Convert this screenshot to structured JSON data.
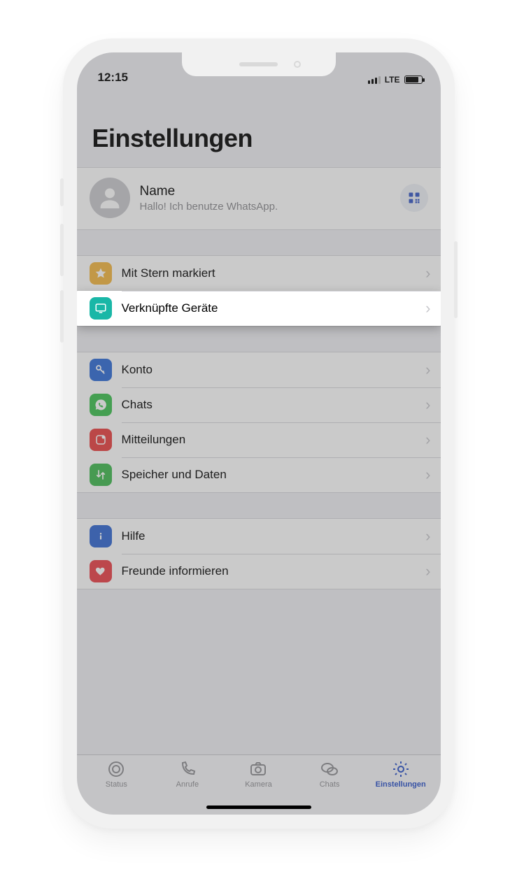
{
  "status": {
    "time": "12:15",
    "network": "LTE"
  },
  "page_title": "Einstellungen",
  "profile": {
    "name": "Name",
    "status": "Hallo! Ich benutze WhatsApp."
  },
  "group1": {
    "items": [
      {
        "label": "Mit Stern markiert",
        "icon": "star",
        "ic_class": "ic-yellow",
        "name": "row-starred",
        "highlight": false
      },
      {
        "label": "Verknüpfte Geräte",
        "icon": "monitor",
        "ic_class": "ic-teal",
        "name": "row-linked-devices",
        "highlight": true
      }
    ]
  },
  "group2": {
    "items": [
      {
        "label": "Konto",
        "icon": "key",
        "ic_class": "ic-blue",
        "name": "row-account"
      },
      {
        "label": "Chats",
        "icon": "whatsapp",
        "ic_class": "ic-green",
        "name": "row-chats"
      },
      {
        "label": "Mitteilungen",
        "icon": "bell",
        "ic_class": "ic-red",
        "name": "row-notifications"
      },
      {
        "label": "Speicher und Daten",
        "icon": "arrows",
        "ic_class": "ic-green2",
        "name": "row-storage"
      }
    ]
  },
  "group3": {
    "items": [
      {
        "label": "Hilfe",
        "icon": "info",
        "ic_class": "ic-blue2",
        "name": "row-help"
      },
      {
        "label": "Freunde informieren",
        "icon": "heart",
        "ic_class": "ic-heart",
        "name": "row-tell-friends"
      }
    ]
  },
  "tabs": [
    {
      "label": "Status",
      "icon": "status",
      "name": "tab-status",
      "active": false
    },
    {
      "label": "Anrufe",
      "icon": "phone",
      "name": "tab-calls",
      "active": false
    },
    {
      "label": "Kamera",
      "icon": "camera",
      "name": "tab-camera",
      "active": false
    },
    {
      "label": "Chats",
      "icon": "chats",
      "name": "tab-chats",
      "active": false
    },
    {
      "label": "Einstellungen",
      "icon": "gear",
      "name": "tab-settings",
      "active": true
    }
  ]
}
